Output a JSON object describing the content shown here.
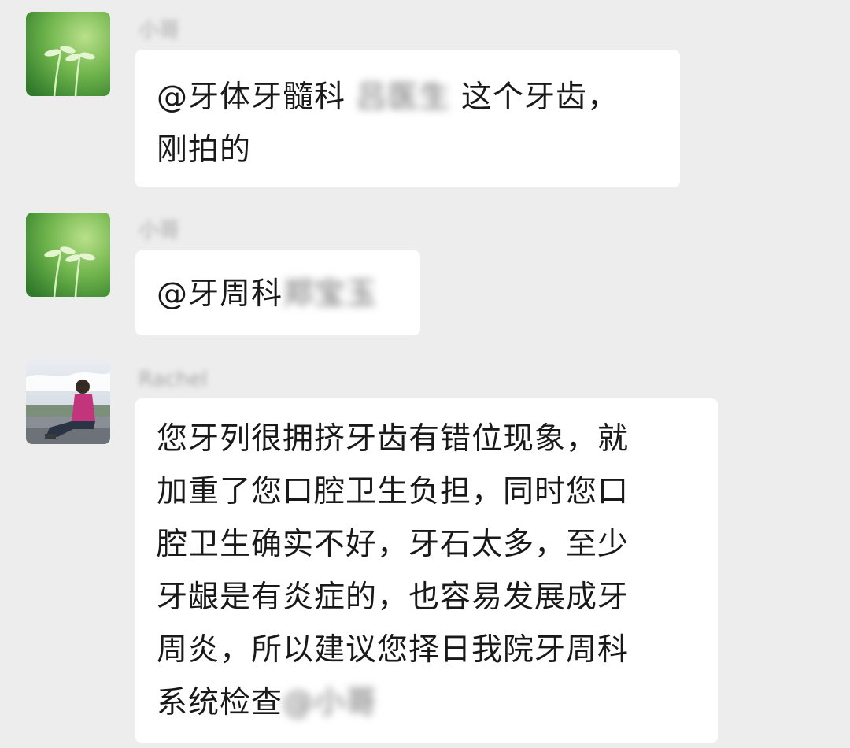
{
  "messages": [
    {
      "sender": "小哥",
      "avatar": "sprout-plant-avatar",
      "lines": [
        {
          "parts": [
            {
              "text": "@牙体牙髓科 ",
              "blur": false
            },
            {
              "text": "吕医生",
              "blur": true
            },
            {
              "text": " 这个牙齿，",
              "blur": false
            }
          ]
        },
        {
          "parts": [
            {
              "text": "刚拍的",
              "blur": false
            }
          ]
        }
      ]
    },
    {
      "sender": "小哥",
      "avatar": "sprout-plant-avatar",
      "lines": [
        {
          "parts": [
            {
              "text": "@牙周科",
              "blur": false
            },
            {
              "text": "郑宝玉",
              "blur": true
            }
          ]
        }
      ]
    },
    {
      "sender": "Rachel",
      "avatar": "woman-sitting-outdoors-avatar",
      "lines": [
        {
          "parts": [
            {
              "text": "您牙列很拥挤牙齿有错位现象，就",
              "blur": false
            }
          ]
        },
        {
          "parts": [
            {
              "text": "加重了您口腔卫生负担，同时您口",
              "blur": false
            }
          ]
        },
        {
          "parts": [
            {
              "text": "腔卫生确实不好，牙石太多，至少",
              "blur": false
            }
          ]
        },
        {
          "parts": [
            {
              "text": "牙龈是有炎症的，也容易发展成牙",
              "blur": false
            }
          ]
        },
        {
          "parts": [
            {
              "text": "周炎，所以建议您择日我院牙周科",
              "blur": false
            }
          ]
        },
        {
          "parts": [
            {
              "text": "系统检查",
              "blur": false
            },
            {
              "text": "@小哥",
              "blur": true
            }
          ]
        }
      ]
    }
  ]
}
